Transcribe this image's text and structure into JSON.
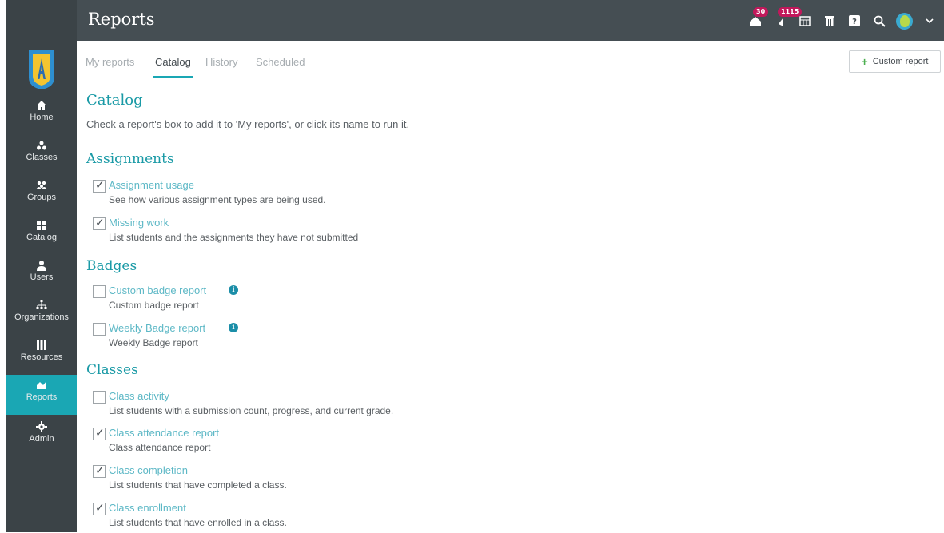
{
  "header": {
    "title": "Reports",
    "badges": {
      "notifications": "30",
      "alerts": "1115"
    },
    "icons": [
      "notification-icon",
      "alert-icon",
      "calendar-icon",
      "trash-icon",
      "help-icon",
      "search-icon",
      "avatar",
      "chevron-down-icon"
    ]
  },
  "colors": {
    "accent": "#1aa7b4",
    "sidebar": "#3b4347",
    "topbar": "#454e53",
    "badge": "#c2185b"
  },
  "sidebar": {
    "items": [
      {
        "label": "Home",
        "icon": "home-icon"
      },
      {
        "label": "Classes",
        "icon": "classes-icon"
      },
      {
        "label": "Groups",
        "icon": "groups-icon"
      },
      {
        "label": "Catalog",
        "icon": "catalog-icon"
      },
      {
        "label": "Users",
        "icon": "users-icon"
      },
      {
        "label": "Organizations",
        "icon": "organizations-icon"
      },
      {
        "label": "Resources",
        "icon": "resources-icon"
      },
      {
        "label": "Reports",
        "icon": "reports-icon",
        "active": true
      },
      {
        "label": "Admin",
        "icon": "gear-icon"
      }
    ]
  },
  "tabs": [
    {
      "label": "My reports"
    },
    {
      "label": "Catalog",
      "active": true
    },
    {
      "label": "History"
    },
    {
      "label": "Scheduled"
    }
  ],
  "custom_report_button": "Custom report",
  "catalog": {
    "title": "Catalog",
    "intro": "Check a report's box to add it to 'My reports', or click its name to run it."
  },
  "sections": {
    "assignments": {
      "title": "Assignments",
      "reports": [
        {
          "name": "Assignment usage",
          "description": "See how various assignment types are being used.",
          "checked": true
        },
        {
          "name": "Missing work",
          "description": "List students and the assignments they have not submitted",
          "checked": true
        }
      ]
    },
    "badges": {
      "title": "Badges",
      "reports": [
        {
          "name": "Custom badge report",
          "description": "Custom badge report",
          "checked": false,
          "info": true
        },
        {
          "name": "Weekly Badge report",
          "description": "Weekly Badge report",
          "checked": false,
          "info": true
        }
      ]
    },
    "classes": {
      "title": "Classes",
      "reports": [
        {
          "name": "Class activity",
          "description": "List students with a submission count, progress, and current grade.",
          "checked": false
        },
        {
          "name": "Class attendance report",
          "description": "Class attendance report",
          "checked": true
        },
        {
          "name": "Class completion",
          "description": "List students that have completed a class.",
          "checked": true
        },
        {
          "name": "Class enrollment",
          "description": "List students that have enrolled in a class.",
          "checked": true
        }
      ]
    }
  }
}
